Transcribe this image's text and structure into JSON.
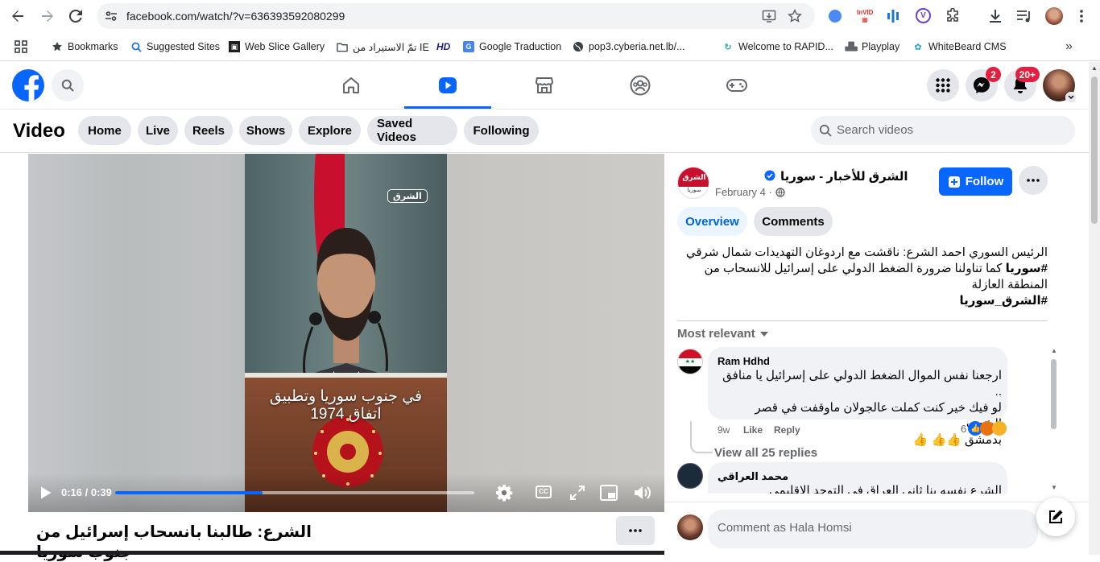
{
  "browser": {
    "url": "facebook.com/watch/?v=636393592080299",
    "bookmarks": [
      {
        "label": "Bookmarks",
        "icon": "star-icon"
      },
      {
        "label": "Suggested Sites",
        "icon": "search-icon"
      },
      {
        "label": "Web Slice Gallery",
        "icon": "web-slice-icon"
      },
      {
        "label": "تمّ الاستيراد من IE",
        "icon": "folder-icon"
      },
      {
        "label": "HD",
        "icon": "hd-icon"
      },
      {
        "label": "Google Traduction",
        "icon": "google-translate-icon"
      },
      {
        "label": "pop3.cyberia.net.lb/...",
        "icon": "globe-icon"
      },
      {
        "label": "Welcome to RAPID...",
        "icon": "rapid-icon"
      },
      {
        "label": "Playplay",
        "icon": "playplay-icon"
      },
      {
        "label": "WhiteBeard CMS",
        "icon": "whitebeard-icon"
      }
    ]
  },
  "facebook": {
    "messenger_badge": "2",
    "notifications_badge": "20+"
  },
  "video_nav": {
    "title": "Video",
    "tabs": [
      "Home",
      "Live",
      "Reels",
      "Shows",
      "Explore",
      "Saved Videos",
      "Following"
    ],
    "search_placeholder": "Search videos"
  },
  "player": {
    "time": "0:16 / 0:39",
    "progress_fraction": 0.41,
    "watermark": "الشرق",
    "caption_line1": "في جنوب سوريا وتطبيق",
    "caption_line2": "اتفاق 1974"
  },
  "video_title": "الشرع: طالبنا بانسحاب إسرائيل من جنوب سوريا",
  "post": {
    "page_name": "الشرق للأخبار - سوريا",
    "avatar_text_top": "الشرق",
    "avatar_text_bottom": "سوريا",
    "date": "February 4 ·",
    "follow_label": "Follow",
    "tab_overview": "Overview",
    "tab_comments": "Comments",
    "desc_line1": "الرئيس السوري أحمد الشرع: ناقشت مع أردوغان التهديدات شمال شرقي",
    "desc_line2_tag": "#سوريا",
    "desc_line2_rest": "كما تناولنا ضرورة الضغط الدولي على إسرائيل للانسحاب من",
    "desc_line3": "المنطقة العازلة",
    "desc_line4_tag": "#الشرق_سوريا",
    "sort_label": "Most relevant"
  },
  "comments": [
    {
      "author": "Ram Hdhd",
      "line1": "ارجعنا نفس الموال الضغط الدولي على إسرائيل يا منافق ..",
      "line2": "لو فيك خير كنت كملت عالجولان ماوقفت في قصر الشعب",
      "line3": "بدمشق 👍👍 👍",
      "age": "9w",
      "like": "Like",
      "reply": "Reply",
      "reactions_count": "6",
      "view_replies": "View all 25 replies"
    },
    {
      "author": "محمد العراقي",
      "line1": "الشرع نفسه بنا ثاني العراق في التوحد الإقليمي"
    }
  ],
  "composer": {
    "placeholder": "Comment as Hala Homsi"
  },
  "colors": {
    "fb_blue": "#0866ff",
    "active_tab_blue": "#0866ff",
    "badge_red": "#e41e3f"
  }
}
